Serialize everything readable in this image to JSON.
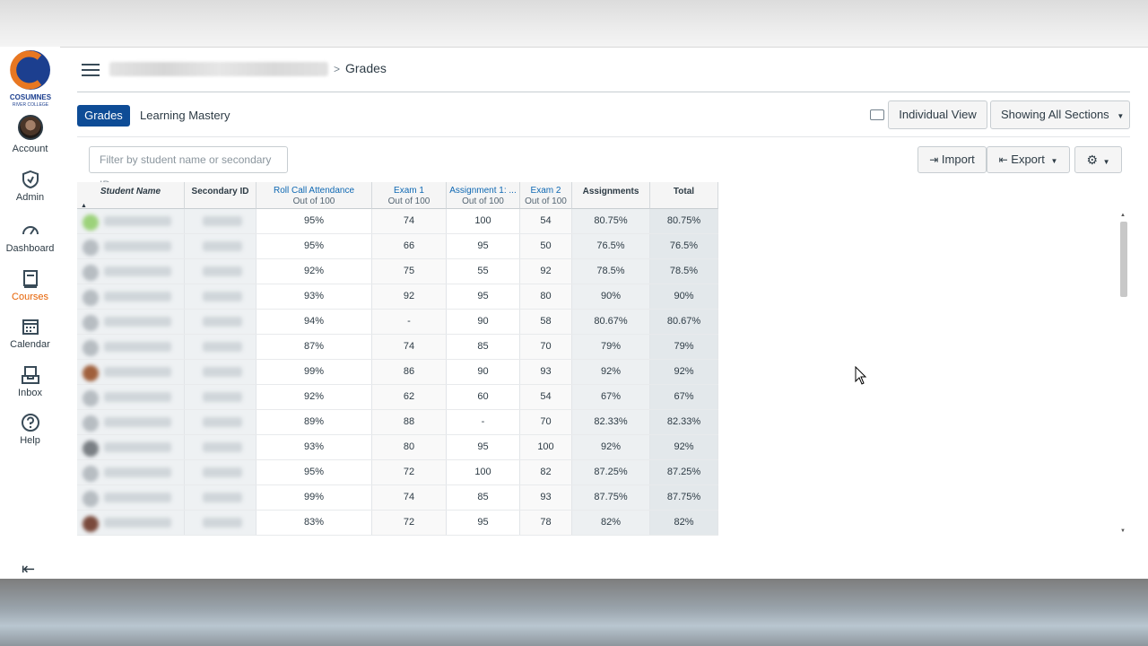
{
  "nav": {
    "logo_text": "COSUMNES",
    "logo_subtext": "RIVER COLLEGE",
    "items": [
      {
        "label": "Account",
        "icon": "avatar"
      },
      {
        "label": "Admin",
        "icon": "shield-icon"
      },
      {
        "label": "Dashboard",
        "icon": "dashboard-icon"
      },
      {
        "label": "Courses",
        "icon": "courses-icon",
        "active": true
      },
      {
        "label": "Calendar",
        "icon": "calendar-icon"
      },
      {
        "label": "Inbox",
        "icon": "inbox-icon"
      },
      {
        "label": "Help",
        "icon": "help-icon"
      }
    ],
    "collapse_glyph": "⇤"
  },
  "breadcrumb": {
    "separator": ">",
    "current": "Grades"
  },
  "tabs": {
    "grades": "Grades",
    "learning_mastery": "Learning Mastery"
  },
  "toolbar": {
    "individual_view": "Individual View",
    "showing_sections": "Showing All Sections",
    "import": "Import",
    "export": "Export"
  },
  "filter": {
    "placeholder": "Filter by student name or secondary ID"
  },
  "colors": {
    "primary": "#0e4c96",
    "active_nav": "#e66000",
    "assignment_link": "#0e68b3"
  },
  "grid": {
    "headers": {
      "student_name": "Student Name",
      "secondary_id": "Secondary ID",
      "roll_call": "Roll Call Attendance",
      "exam1": "Exam 1",
      "assignment1": "Assignment 1: ...",
      "exam2": "Exam 2",
      "assignments": "Assignments",
      "total": "Total",
      "out_of": "Out of 100"
    },
    "rows": [
      {
        "av": "#9cd27a",
        "roll": "95%",
        "exam1": "74",
        "a1": "100",
        "exam2": "54",
        "assign": "80.75%",
        "total": "80.75%"
      },
      {
        "av": "#b7bdc2",
        "roll": "95%",
        "exam1": "66",
        "a1": "95",
        "exam2": "50",
        "assign": "76.5%",
        "total": "76.5%"
      },
      {
        "av": "#b7bdc2",
        "roll": "92%",
        "exam1": "75",
        "a1": "55",
        "exam2": "92",
        "assign": "78.5%",
        "total": "78.5%"
      },
      {
        "av": "#b7bdc2",
        "roll": "93%",
        "exam1": "92",
        "a1": "95",
        "exam2": "80",
        "assign": "90%",
        "total": "90%"
      },
      {
        "av": "#b7bdc2",
        "roll": "94%",
        "exam1": "-",
        "a1": "90",
        "exam2": "58",
        "assign": "80.67%",
        "total": "80.67%"
      },
      {
        "av": "#b7bdc2",
        "roll": "87%",
        "exam1": "74",
        "a1": "85",
        "exam2": "70",
        "assign": "79%",
        "total": "79%"
      },
      {
        "av": "#a0603c",
        "roll": "99%",
        "exam1": "86",
        "a1": "90",
        "exam2": "93",
        "assign": "92%",
        "total": "92%"
      },
      {
        "av": "#b7bdc2",
        "roll": "92%",
        "exam1": "62",
        "a1": "60",
        "exam2": "54",
        "assign": "67%",
        "total": "67%"
      },
      {
        "av": "#b7bdc2",
        "roll": "89%",
        "exam1": "88",
        "a1": "-",
        "exam2": "70",
        "assign": "82.33%",
        "total": "82.33%"
      },
      {
        "av": "#7a7f84",
        "roll": "93%",
        "exam1": "80",
        "a1": "95",
        "exam2": "100",
        "assign": "92%",
        "total": "92%"
      },
      {
        "av": "#b7bdc2",
        "roll": "95%",
        "exam1": "72",
        "a1": "100",
        "exam2": "82",
        "assign": "87.25%",
        "total": "87.25%"
      },
      {
        "av": "#b7bdc2",
        "roll": "99%",
        "exam1": "74",
        "a1": "85",
        "exam2": "93",
        "assign": "87.75%",
        "total": "87.75%"
      },
      {
        "av": "#7a4a3c",
        "roll": "83%",
        "exam1": "72",
        "a1": "95",
        "exam2": "78",
        "assign": "82%",
        "total": "82%"
      }
    ]
  }
}
